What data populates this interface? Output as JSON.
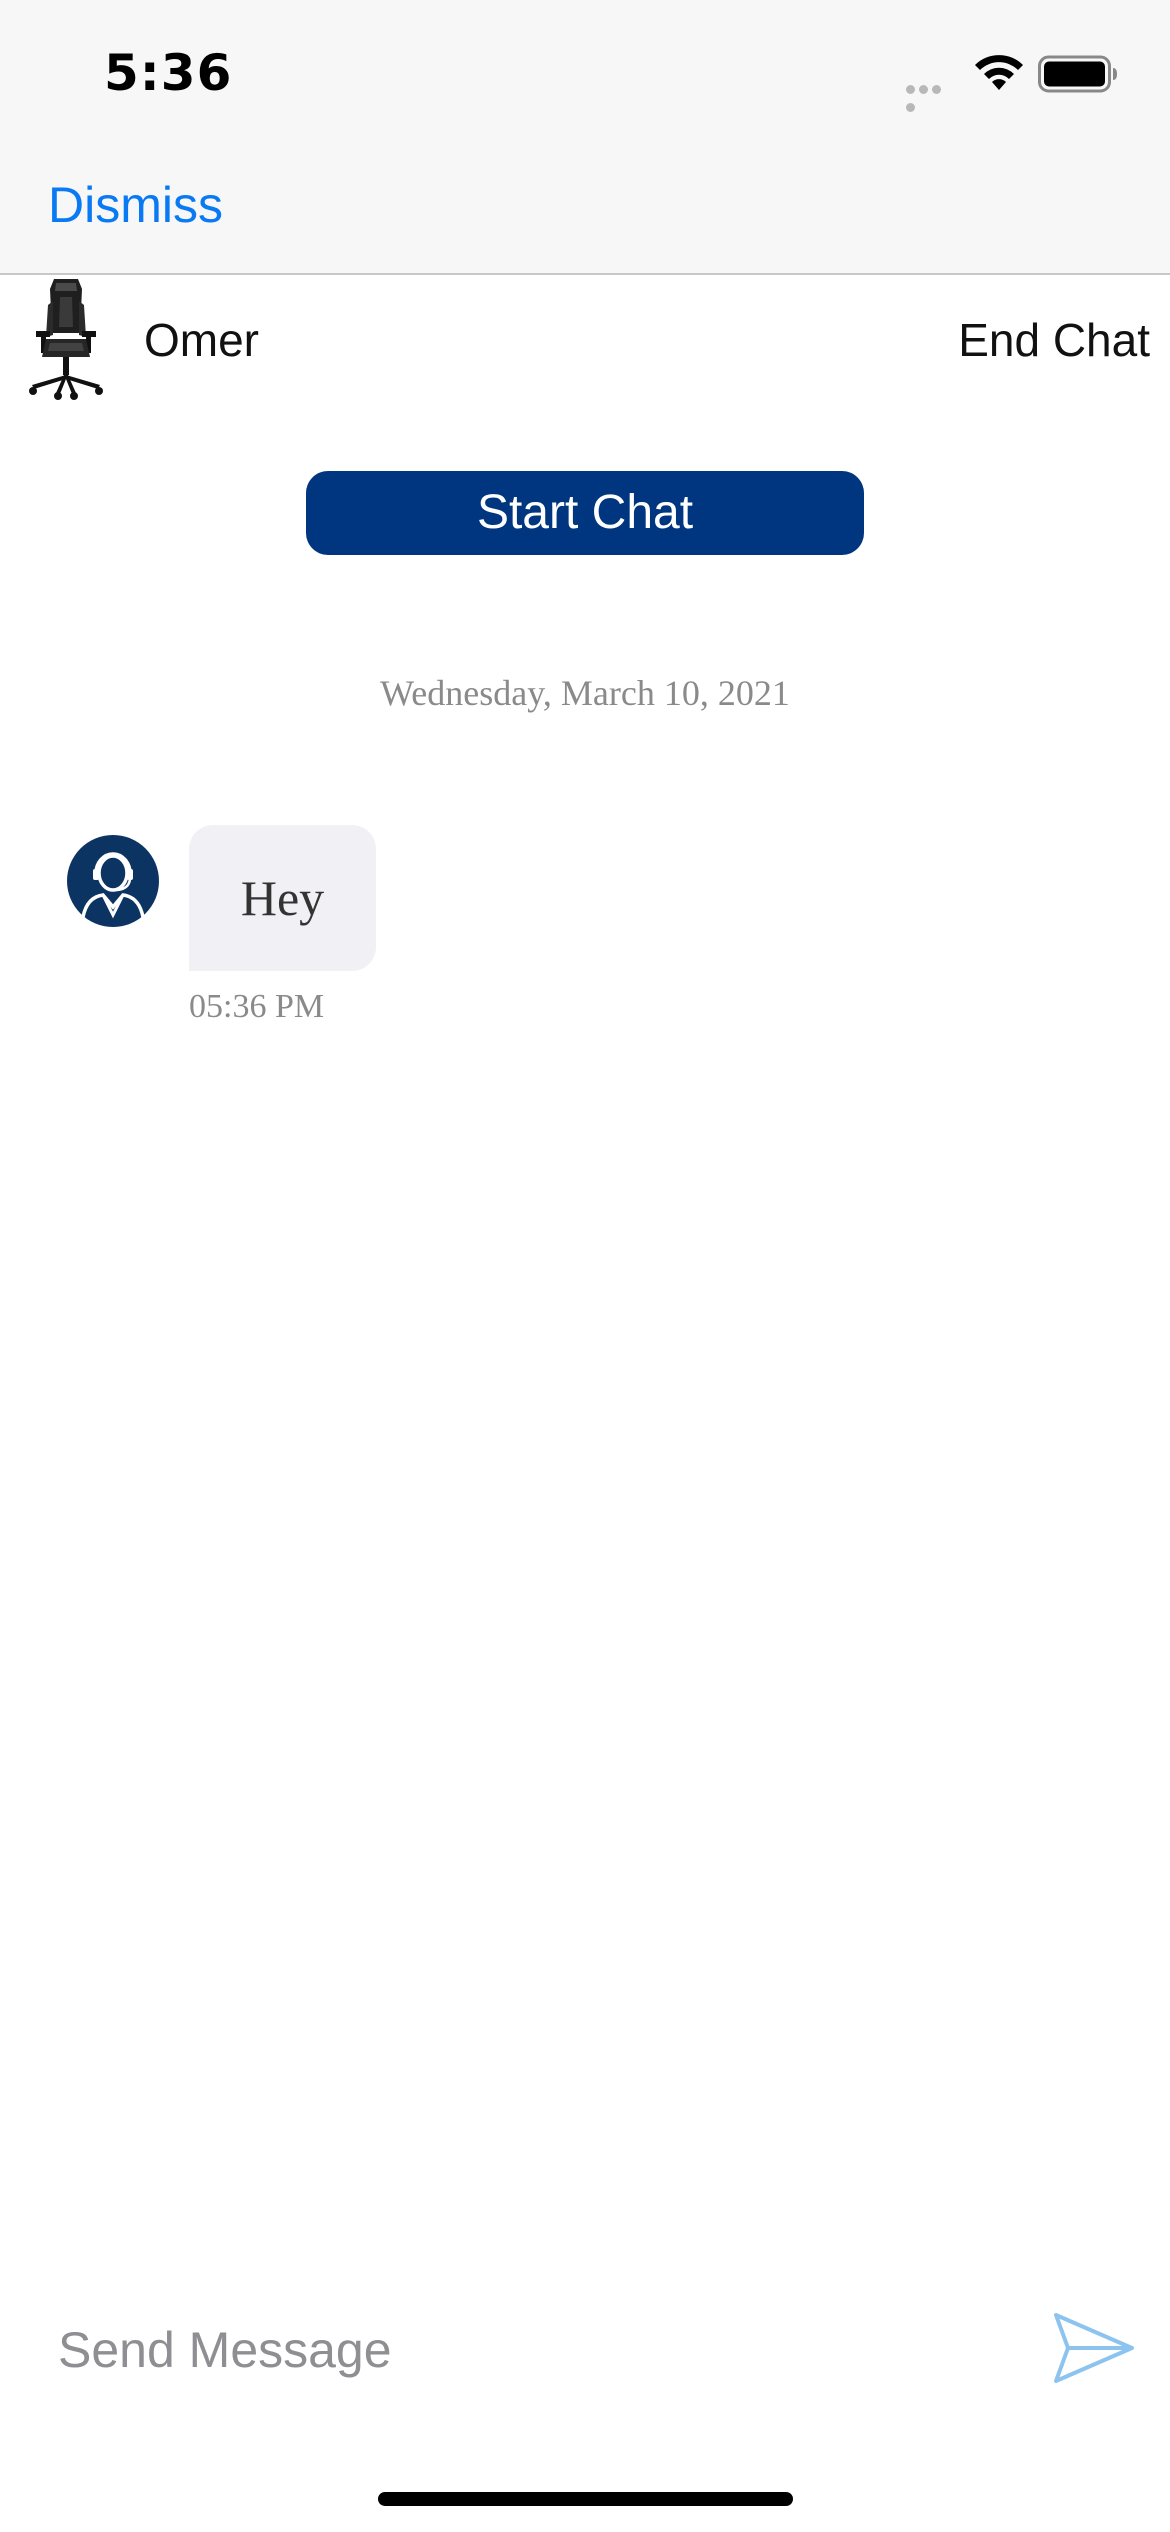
{
  "status_bar": {
    "time": "5:36",
    "icons": [
      "signal-dots-icon",
      "wifi-icon",
      "battery-icon"
    ]
  },
  "nav": {
    "dismiss_label": "Dismiss"
  },
  "chat_header": {
    "agent_name": "Omer",
    "agent_avatar_icon": "gaming-chair-icon",
    "end_chat_label": "End Chat"
  },
  "start_chat": {
    "label": "Start Chat",
    "bg_color": "#003580"
  },
  "conversation": {
    "date": "Wednesday, March 10, 2021",
    "messages": [
      {
        "sender_icon": "support-agent-avatar-icon",
        "text": "Hey",
        "time": "05:36 PM"
      }
    ]
  },
  "composer": {
    "placeholder": "Send Message",
    "send_icon": "send-arrow-icon"
  },
  "colors": {
    "accent": "#0a7af4",
    "brand_navy": "#003580",
    "bubble": "#f0f0f5",
    "send_icon": "#8cc4ef"
  }
}
